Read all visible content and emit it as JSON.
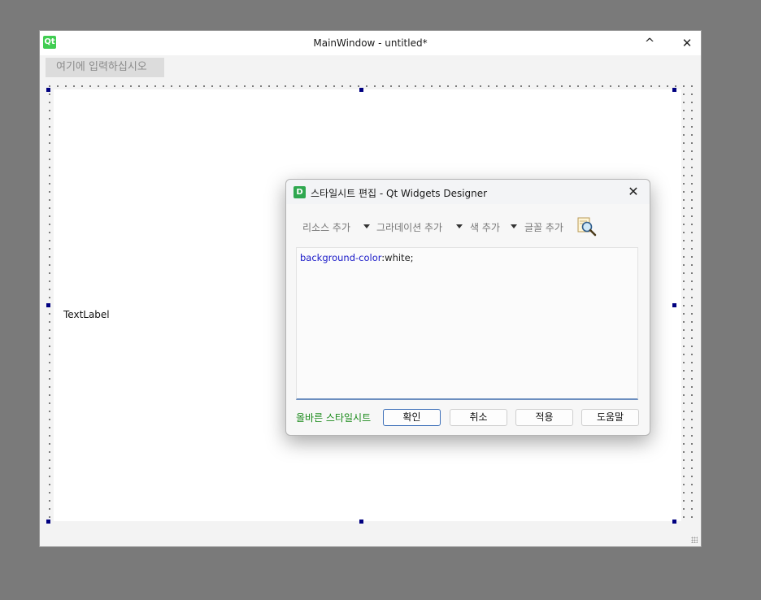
{
  "window": {
    "title": "MainWindow - untitled*",
    "logo_text": "Qt",
    "minimize_glyph": "^",
    "close_glyph": "✕"
  },
  "menubar": {
    "placeholder": "여기에 입력하십시오"
  },
  "central": {
    "label_text": "TextLabel"
  },
  "dialog": {
    "icon_text": "D",
    "title": "스타일시트 편집 - Qt Widgets Designer",
    "close_glyph": "✕",
    "toolbar": {
      "add_resource": "리소스 추가",
      "add_gradient": "그라데이션 추가",
      "add_color": "색 추가",
      "add_font": "글꼴 추가",
      "search_icon": "magnifier-icon"
    },
    "editor": {
      "property": "background-color",
      "value": ":white;"
    },
    "status": "올바른 스타일시트",
    "buttons": {
      "ok": "확인",
      "cancel": "취소",
      "apply": "적용",
      "help": "도움말"
    }
  }
}
